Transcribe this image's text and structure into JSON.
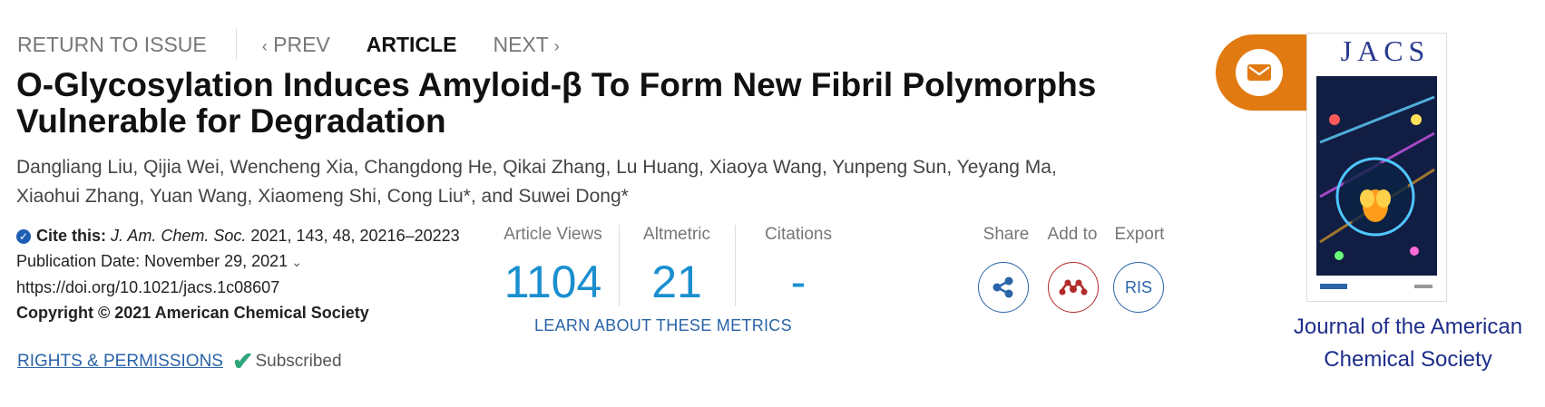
{
  "nav": {
    "return": "RETURN TO ISSUE",
    "prev": "PREV",
    "article": "ARTICLE",
    "next": "NEXT"
  },
  "article": {
    "title": "O-Glycosylation Induces Amyloid-β To Form New Fibril Polymorphs Vulnerable for Degradation",
    "authors_line1": "Dangliang Liu, Qijia Wei, Wencheng Xia, Changdong He, Qikai Zhang, Lu Huang, Xiaoya Wang, Yunpeng Sun, Yeyang Ma,",
    "authors_line2": "Xiaohui Zhang, Yuan Wang, Xiaomeng Shi, Cong Liu*, and Suwei Dong*"
  },
  "cite": {
    "label": "Cite this:",
    "journal": "J. Am. Chem. Soc.",
    "details": "2021, 143, 48, 20216–20223",
    "pub_date": "Publication Date: November 29, 2021",
    "doi": "https://doi.org/10.1021/jacs.1c08607",
    "copyright": "Copyright © 2021 American Chemical Society",
    "rights": "RIGHTS & PERMISSIONS",
    "subscribed": "Subscribed"
  },
  "metrics": {
    "views_label": "Article Views",
    "views_value": "1104",
    "altmetric_label": "Altmetric",
    "altmetric_value": "21",
    "citations_label": "Citations",
    "citations_value": "-",
    "learn": "LEARN ABOUT THESE METRICS"
  },
  "actions": {
    "share": "Share",
    "add_to": "Add to",
    "export": "Export",
    "ris": "RIS"
  },
  "journal": {
    "cover_title": "JACS",
    "name": "Journal of the American Chemical Society"
  },
  "colors": {
    "accent_blue": "#1a8fd0",
    "link_blue": "#2a64a8",
    "mail_orange": "#e27a12",
    "mendeley_red": "#b22a2a",
    "journal_navy": "#1e2e8a"
  }
}
